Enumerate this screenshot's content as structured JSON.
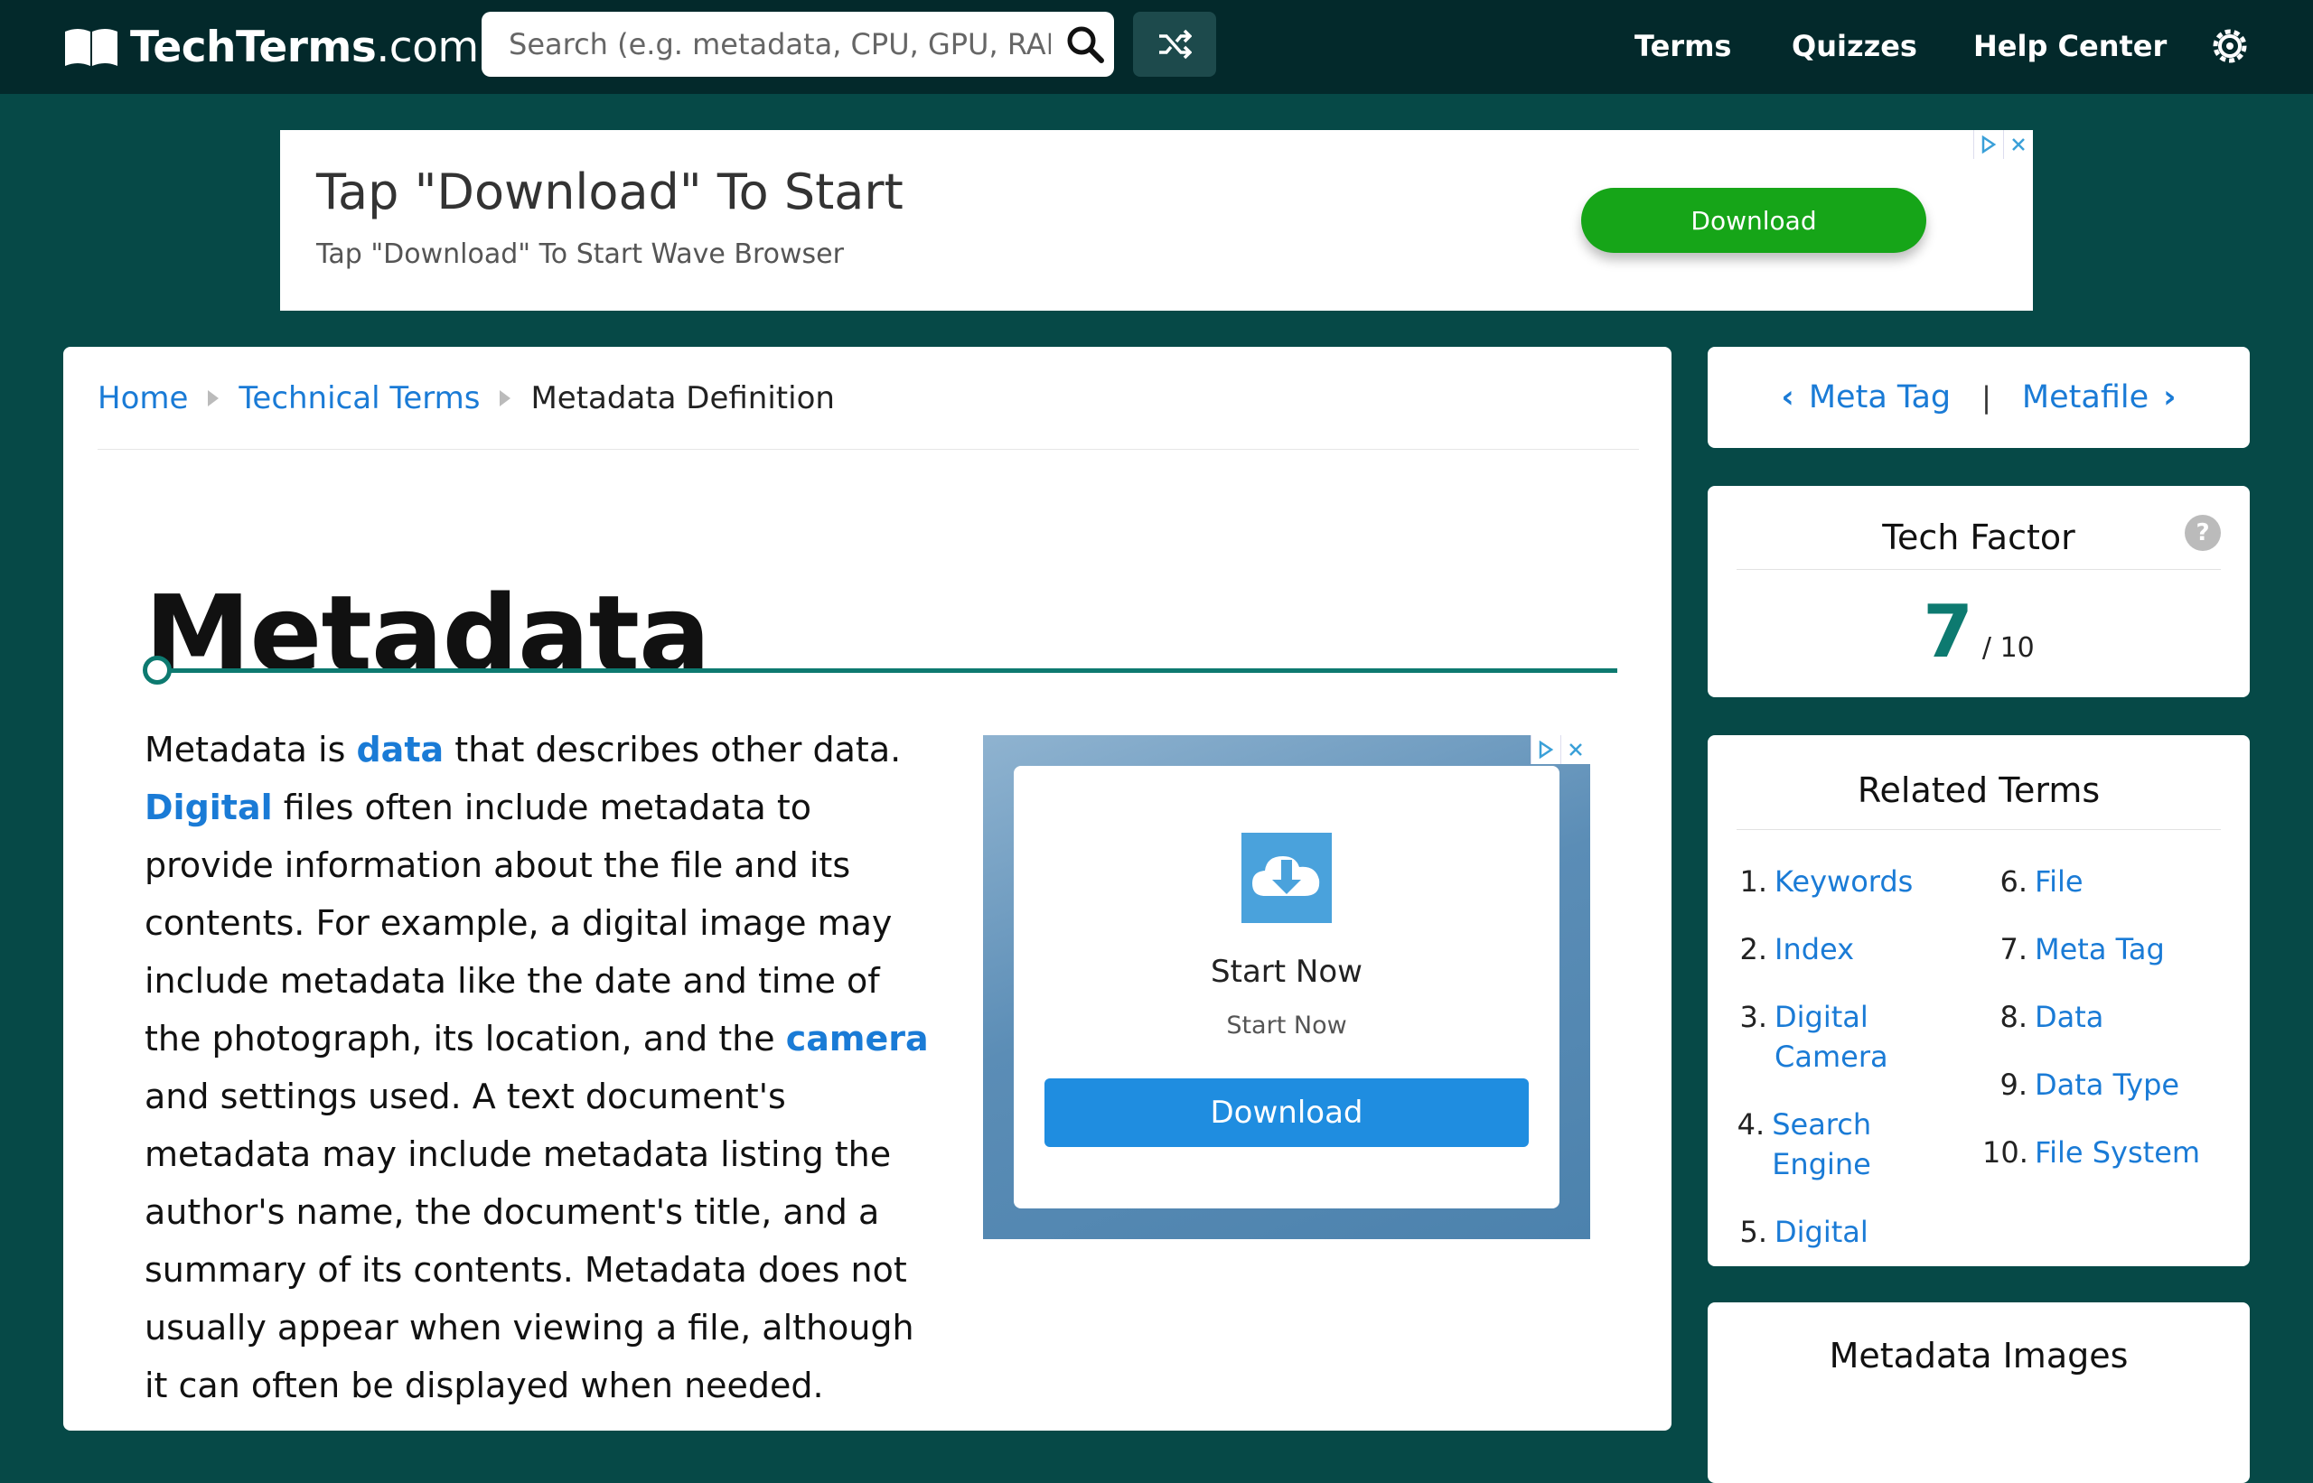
{
  "site": {
    "logo_text": "TechTerms",
    "logo_domain": ".com",
    "search_placeholder": "Search (e.g. metadata, CPU, GPU, RAM)",
    "nav": [
      "Terms",
      "Quizzes",
      "Help Center"
    ]
  },
  "top_ad": {
    "title": "Tap \"Download\" To Start",
    "subtitle": "Tap \"Download\" To Start Wave Browser",
    "button": "Download"
  },
  "breadcrumb": [
    "Home",
    "Technical Terms",
    "Metadata Definition"
  ],
  "page_title": "Metadata",
  "definition": {
    "t1": "Metadata is ",
    "l1": "data",
    "t2": " that describes other data. ",
    "l2": "Digital",
    "t3": " files often include metadata to provide information about the file and its contents. For example, a digital image may include metadata like the date and time of the photograph, its location, and the ",
    "l3": "camera",
    "t4": " and settings used. A text document's metadata may include metadata listing the author's name, the document's title, and a summary of its contents. Metadata does not usually appear when viewing a file, although it can often be displayed when needed."
  },
  "side_ad": {
    "title": "Start Now",
    "subtitle": "Start Now",
    "button": "Download"
  },
  "prev_next": {
    "prev": "Meta Tag",
    "separator": "|",
    "next": "Metafile"
  },
  "tech_factor": {
    "title": "Tech Factor",
    "help": "?",
    "score": "7",
    "out_of": "/ 10"
  },
  "related_terms": {
    "title": "Related Terms",
    "items": [
      {
        "num": "1.",
        "label": "Keywords"
      },
      {
        "num": "2.",
        "label": "Index"
      },
      {
        "num": "3.",
        "label": "Digital Camera"
      },
      {
        "num": "4.",
        "label": "Search Engine"
      },
      {
        "num": "5.",
        "label": "Digital"
      },
      {
        "num": "6.",
        "label": "File"
      },
      {
        "num": "7.",
        "label": "Meta Tag"
      },
      {
        "num": "8.",
        "label": "Data"
      },
      {
        "num": "9.",
        "label": "Data Type"
      },
      {
        "num": "10.",
        "label": "File System"
      }
    ]
  },
  "images_card": {
    "title": "Metadata Images"
  }
}
